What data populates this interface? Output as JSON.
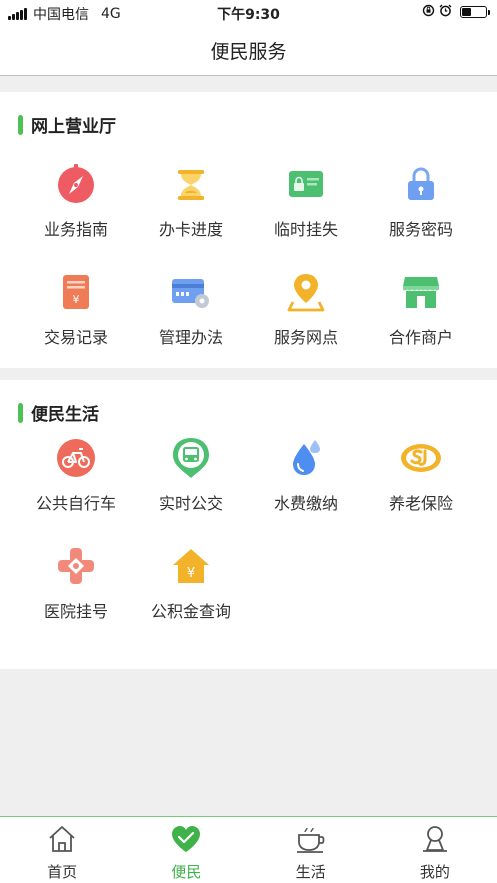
{
  "status_bar": {
    "carrier": "中国电信",
    "network": "4G",
    "time": "下午9:30"
  },
  "header": {
    "title": "便民服务"
  },
  "sections": [
    {
      "title": "网上营业厅",
      "items": [
        {
          "label": "业务指南",
          "icon": "compass-icon"
        },
        {
          "label": "办卡进度",
          "icon": "hourglass-icon"
        },
        {
          "label": "临时挂失",
          "icon": "card-lock-icon"
        },
        {
          "label": "服务密码",
          "icon": "padlock-icon"
        },
        {
          "label": "交易记录",
          "icon": "receipt-icon"
        },
        {
          "label": "管理办法",
          "icon": "card-gear-icon"
        },
        {
          "label": "服务网点",
          "icon": "map-pin-icon"
        },
        {
          "label": "合作商户",
          "icon": "storefront-icon"
        }
      ]
    },
    {
      "title": "便民生活",
      "items": [
        {
          "label": "公共自行车",
          "icon": "bicycle-icon"
        },
        {
          "label": "实时公交",
          "icon": "bus-icon"
        },
        {
          "label": "水费缴纳",
          "icon": "water-drop-icon"
        },
        {
          "label": "养老保险",
          "icon": "social-insurance-icon"
        },
        {
          "label": "医院挂号",
          "icon": "medical-cross-icon"
        },
        {
          "label": "公积金查询",
          "icon": "housing-fund-icon"
        }
      ]
    }
  ],
  "tabbar": {
    "active": "便民",
    "tabs": [
      {
        "label": "首页",
        "icon": "home-icon"
      },
      {
        "label": "便民",
        "icon": "heart-icon"
      },
      {
        "label": "生活",
        "icon": "coffee-cup-icon"
      },
      {
        "label": "我的",
        "icon": "user-icon"
      }
    ]
  },
  "colors": {
    "accent": "#3fb24a",
    "section_bar": "#4fc256",
    "background": "#efefef"
  }
}
